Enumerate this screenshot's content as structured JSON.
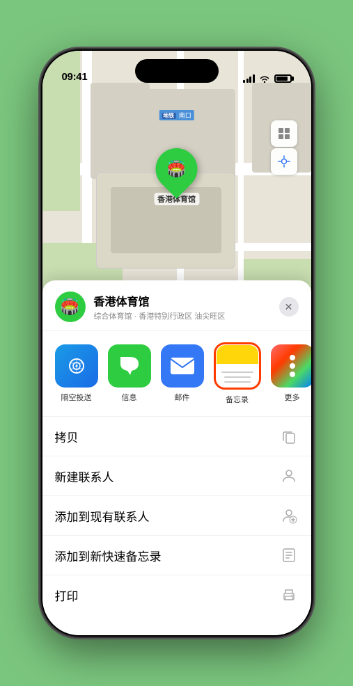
{
  "statusBar": {
    "time": "09:41",
    "locationArrow": "▶"
  },
  "mapLabels": {
    "metro": "南口"
  },
  "pin": {
    "label": "香港体育馆"
  },
  "venue": {
    "name": "香港体育馆",
    "subtitle": "综合体育馆 · 香港特别行政区 油尖旺区",
    "iconEmoji": "🏟️"
  },
  "shareItems": [
    {
      "id": "airdrop",
      "label": "隔空投送",
      "emoji": "📡"
    },
    {
      "id": "messages",
      "label": "信息",
      "emoji": "💬"
    },
    {
      "id": "mail",
      "label": "邮件",
      "emoji": "✉️"
    },
    {
      "id": "notes",
      "label": "备忘录",
      "emoji": ""
    },
    {
      "id": "more",
      "label": "更多",
      "emoji": ""
    }
  ],
  "actionRows": [
    {
      "id": "copy",
      "label": "拷贝",
      "iconUnicode": "⊙"
    },
    {
      "id": "new-contact",
      "label": "新建联系人",
      "iconUnicode": "👤"
    },
    {
      "id": "add-existing",
      "label": "添加到现有联系人",
      "iconUnicode": "👤"
    },
    {
      "id": "add-notes",
      "label": "添加到新快速备忘录",
      "iconUnicode": "📋"
    },
    {
      "id": "print",
      "label": "打印",
      "iconUnicode": "🖨️"
    }
  ],
  "colors": {
    "green": "#2ecc40",
    "blue": "#3478f6",
    "red": "#ff3b00",
    "yellow": "#ffd60a"
  }
}
